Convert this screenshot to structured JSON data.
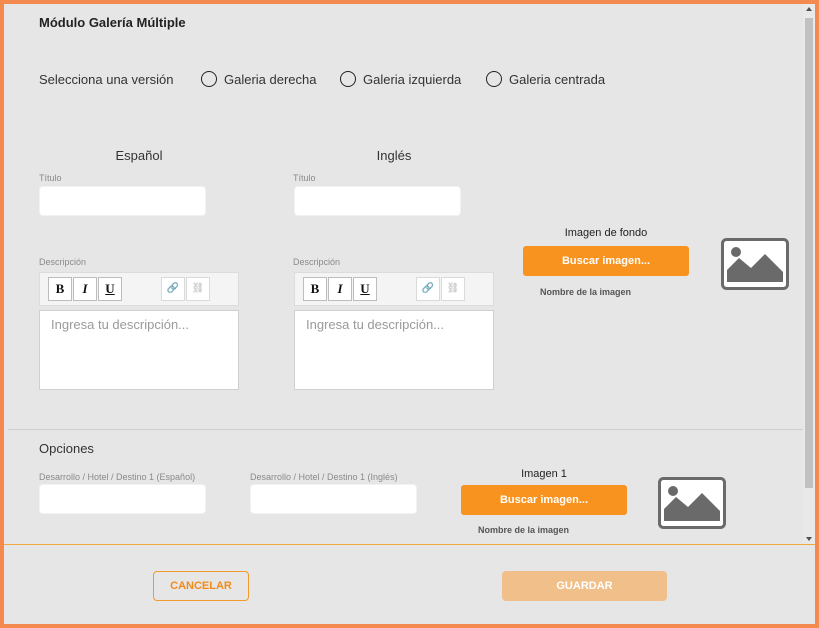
{
  "modal": {
    "title": "Módulo Galería Múltiple"
  },
  "version": {
    "label": "Selecciona una versión",
    "options": [
      "Galeria derecha",
      "Galeria izquierda",
      "Galeria centrada"
    ]
  },
  "spanish": {
    "heading": "Español",
    "title_label": "Título",
    "title_value": "",
    "description_label": "Descripción",
    "description_placeholder": "Ingresa tu descripción..."
  },
  "english": {
    "heading": "Inglés",
    "title_label": "Título",
    "title_value": "",
    "description_label": "Descripción",
    "description_placeholder": "Ingresa tu descripción..."
  },
  "editor_toolbar": {
    "bold": "B",
    "italic": "I",
    "underline": "U",
    "link_icon": "link-icon",
    "unlink_icon": "unlink-icon"
  },
  "background_image": {
    "title": "Imagen de fondo",
    "button": "Buscar imagen...",
    "filename_label": "Nombre de la imagen",
    "icon": "image-placeholder-icon"
  },
  "options": {
    "heading": "Opciones",
    "field_es_label": "Desarrollo / Hotel / Destino 1 (Español)",
    "field_en_label": "Desarrollo / Hotel / Destino 1 (Inglés)",
    "field_es_value": "",
    "field_en_value": "",
    "image": {
      "title": "Imagen 1",
      "button": "Buscar imagen...",
      "filename_label": "Nombre de la imagen",
      "icon": "image-placeholder-icon"
    }
  },
  "footer": {
    "cancel": "CANCELAR",
    "save": "GUARDAR"
  },
  "colors": {
    "accent": "#f7931e",
    "border": "#f58a50",
    "save_disabled": "#f1c08a"
  }
}
